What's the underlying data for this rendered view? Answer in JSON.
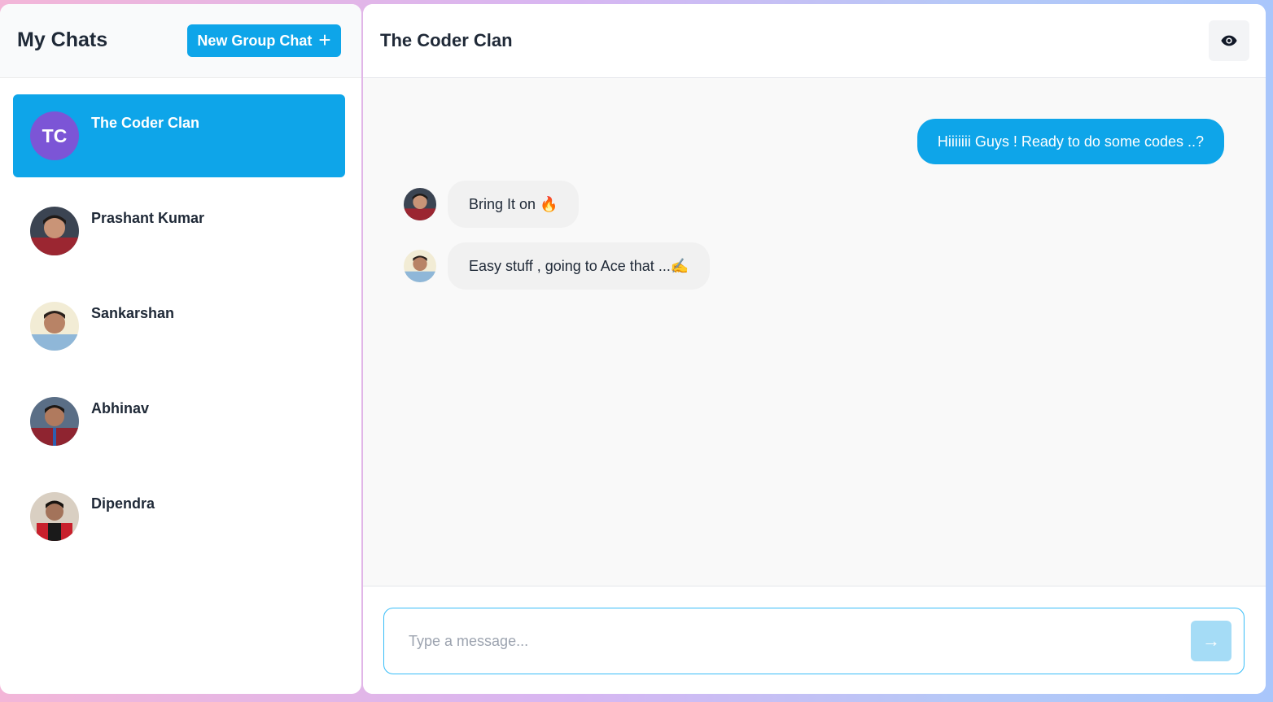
{
  "sidebar": {
    "title": "My Chats",
    "new_group_label": "New Group Chat",
    "new_group_icon": "+",
    "chats": [
      {
        "name": "The Coder Clan",
        "initials": "TC",
        "active": true
      },
      {
        "name": "Prashant Kumar",
        "active": false
      },
      {
        "name": "Sankarshan",
        "active": false
      },
      {
        "name": "Abhinav",
        "active": false
      },
      {
        "name": "Dipendra",
        "active": false
      }
    ]
  },
  "chat": {
    "title": "The Coder Clan",
    "view_icon": "eye-icon",
    "messages": [
      {
        "direction": "outgoing",
        "text": "Hiiiiiii Guys ! Ready to do some codes ..?"
      },
      {
        "direction": "incoming",
        "sender": "Prashant Kumar",
        "text": "Bring It on 🔥"
      },
      {
        "direction": "incoming",
        "sender": "Sankarshan",
        "text": "Easy stuff , going to Ace that ...✍️"
      }
    ]
  },
  "composer": {
    "placeholder": "Type a message...",
    "send_icon": "→"
  },
  "colors": {
    "accent": "#0ea5e9",
    "initials_avatar": "#7c55d6",
    "send_disabled": "#a5dcf6"
  }
}
